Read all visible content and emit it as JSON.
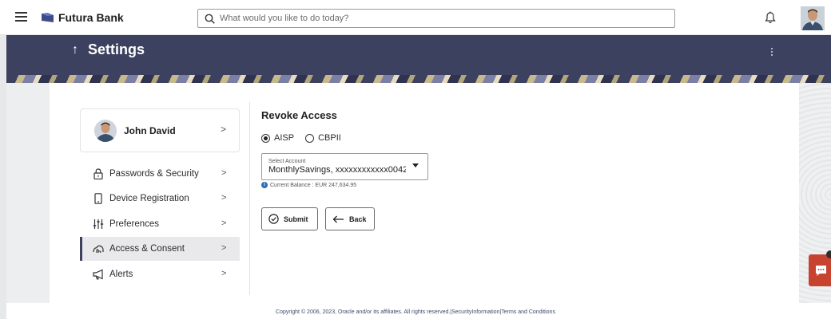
{
  "topbar": {
    "brand_name": "Futura Bank",
    "search_placeholder": "What would you like to do today?"
  },
  "header": {
    "title": "Settings"
  },
  "profile": {
    "name": "John David"
  },
  "nav": {
    "items": [
      {
        "label": "Passwords & Security",
        "icon": "lock-icon"
      },
      {
        "label": "Device Registration",
        "icon": "device-icon"
      },
      {
        "label": "Preferences",
        "icon": "sliders-icon"
      },
      {
        "label": "Access & Consent",
        "icon": "cloud-hand-icon",
        "active": true
      },
      {
        "label": "Alerts",
        "icon": "megaphone-icon"
      }
    ]
  },
  "form": {
    "title": "Revoke Access",
    "radio_options": [
      "AISP",
      "CBPII"
    ],
    "selected_option": "AISP",
    "select_label": "Select Account",
    "select_value": "MonthlySavings, xxxxxxxxxxxx0042",
    "balance_text": "Current Balance : EUR 247,634.95",
    "submit_label": "Submit",
    "back_label": "Back"
  },
  "footer": {
    "text": "Copyright © 2006, 2023, Oracle and/or its affiliates. All rights reserved.|SecurityInformation|Terms and Conditions"
  },
  "colors": {
    "header_bg": "#3d4160",
    "chat_button": "#c7432f",
    "info_icon": "#2a6db5"
  }
}
